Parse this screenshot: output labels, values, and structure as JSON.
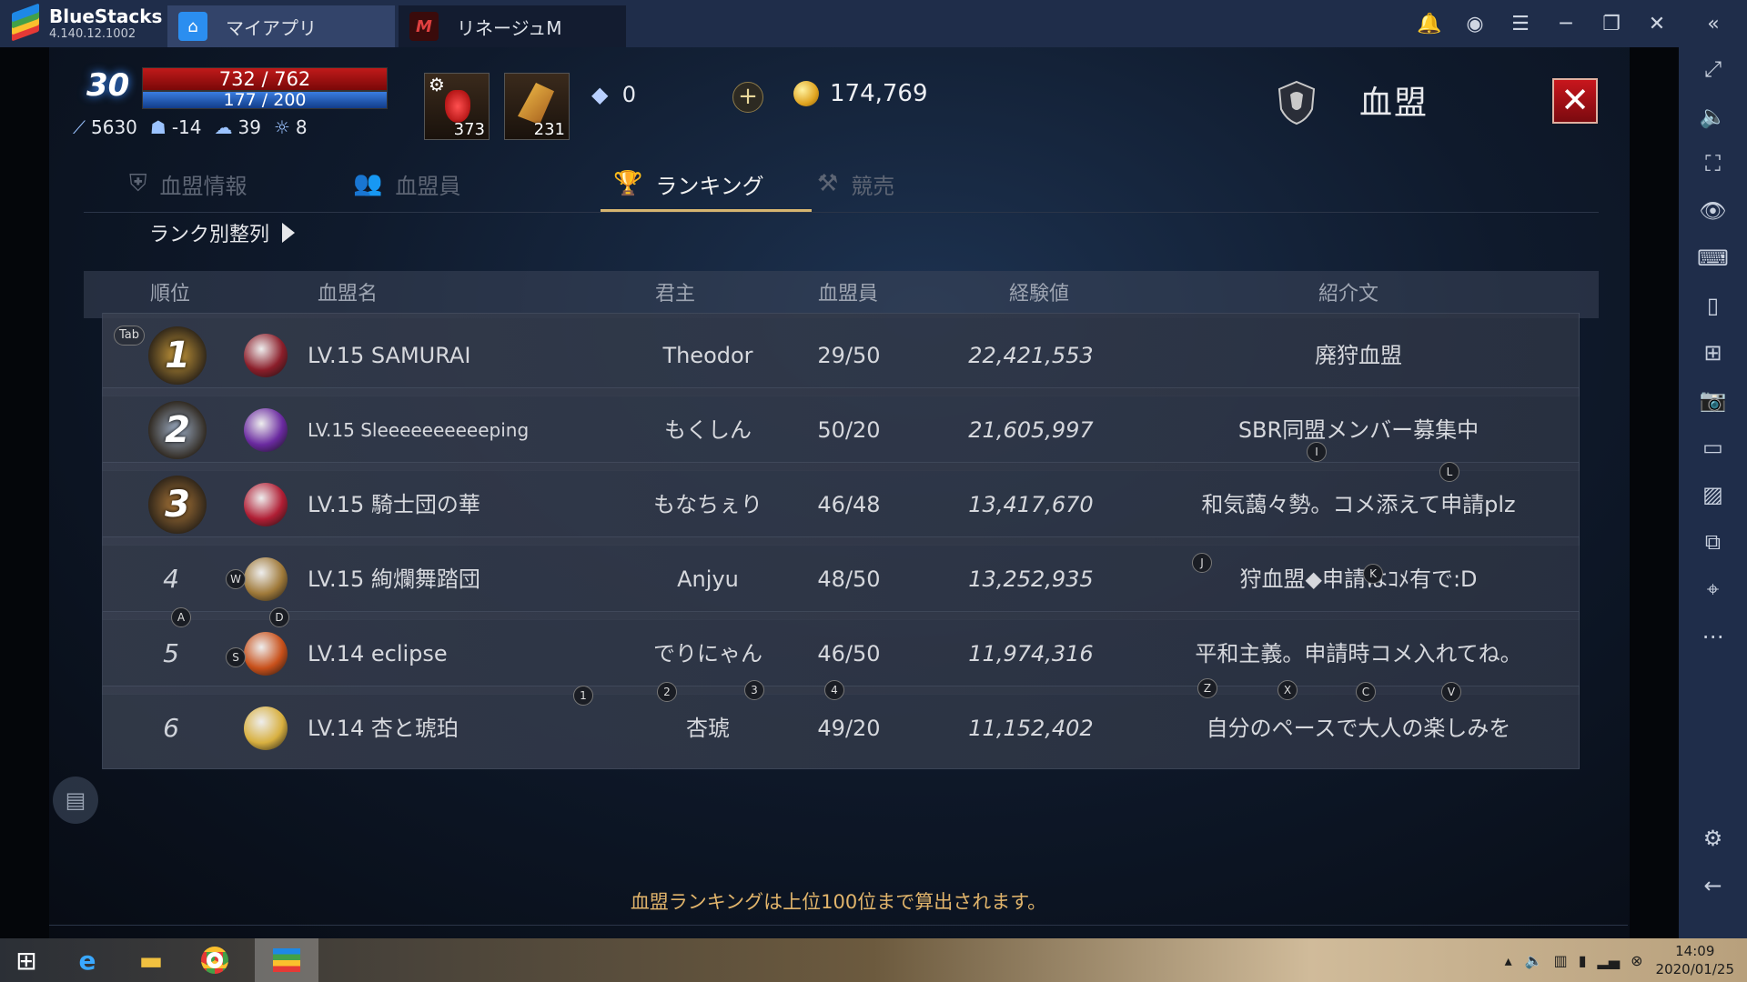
{
  "window": {
    "app_name": "BlueStacks",
    "version": "4.140.12.1002",
    "tabs": [
      {
        "label": "マイアプリ"
      },
      {
        "label": "リネージュM"
      }
    ]
  },
  "hud": {
    "level": "30",
    "hp": "732 / 762",
    "mp": "177 / 200",
    "ac": "5630",
    "stat1": "-14",
    "stat2": "39",
    "stat3": "8",
    "potion_count": "373",
    "feather_count": "231",
    "diamonds": "0",
    "adena": "174,769",
    "panel_title": "血盟"
  },
  "subtabs": [
    {
      "label": "血盟情報"
    },
    {
      "label": "血盟員"
    },
    {
      "label": "ランキング"
    },
    {
      "label": "競売"
    }
  ],
  "sort_label": "ランク別整列",
  "columns": [
    "順位",
    "血盟名",
    "君主",
    "血盟員",
    "経験値",
    "紹介文"
  ],
  "rows": [
    {
      "rank": "1",
      "name": "LV.15 SAMURAI",
      "lord": "Theodor",
      "members": "29/50",
      "exp": "22,421,553",
      "intro": "廃狩血盟",
      "medal_color": "#c89a3a",
      "emblem_color": "#8b1e2a"
    },
    {
      "rank": "2",
      "name": "LV.15 Sleeeeeeeeeeping",
      "lord": "もくしん",
      "members": "50/20",
      "exp": "21,605,997",
      "intro": "SBR同盟メンバー募集中",
      "medal_color": "#9fb0c8",
      "emblem_color": "#6a2aa0"
    },
    {
      "rank": "3",
      "name": "LV.15 騎士団の華",
      "lord": "もなちぇり",
      "members": "46/48",
      "exp": "13,417,670",
      "intro": "和気藹々勢。コメ添えて申請plz",
      "medal_color": "#b07a3a",
      "emblem_color": "#b01e34"
    },
    {
      "rank": "4",
      "name": "LV.15 絢爛舞踏団",
      "lord": "Anjyu",
      "members": "48/50",
      "exp": "13,252,935",
      "intro": "狩血盟◆申請はｺﾒ有で:D",
      "medal_color": "",
      "emblem_color": "#a07a3a"
    },
    {
      "rank": "5",
      "name": "LV.14 eclipse",
      "lord": "でりにゃん",
      "members": "46/50",
      "exp": "11,974,316",
      "intro": "平和主義。申請時コメ入れてね。",
      "medal_color": "",
      "emblem_color": "#c8501a"
    },
    {
      "rank": "6",
      "name": "LV.14 杏と琥珀",
      "lord": "杏琥",
      "members": "49/20",
      "exp": "11,152,402",
      "intro": "自分のペースで大人の楽しみを",
      "medal_color": "",
      "emblem_color": "#d8b040"
    }
  ],
  "footer_note": "血盟ランキングは上位100位まで算出されます。",
  "key_badges": [
    "Tab",
    "I",
    "L",
    "J",
    "K",
    "W",
    "A",
    "D",
    "S",
    "1",
    "2",
    "3",
    "4",
    "Z",
    "X",
    "C",
    "V"
  ],
  "taskbar": {
    "time": "14:09",
    "date": "2020/01/25"
  },
  "colors": {
    "titlebar": "#1f2d4a",
    "close_button": "#c8161d",
    "accent_gold": "#d6b570"
  }
}
